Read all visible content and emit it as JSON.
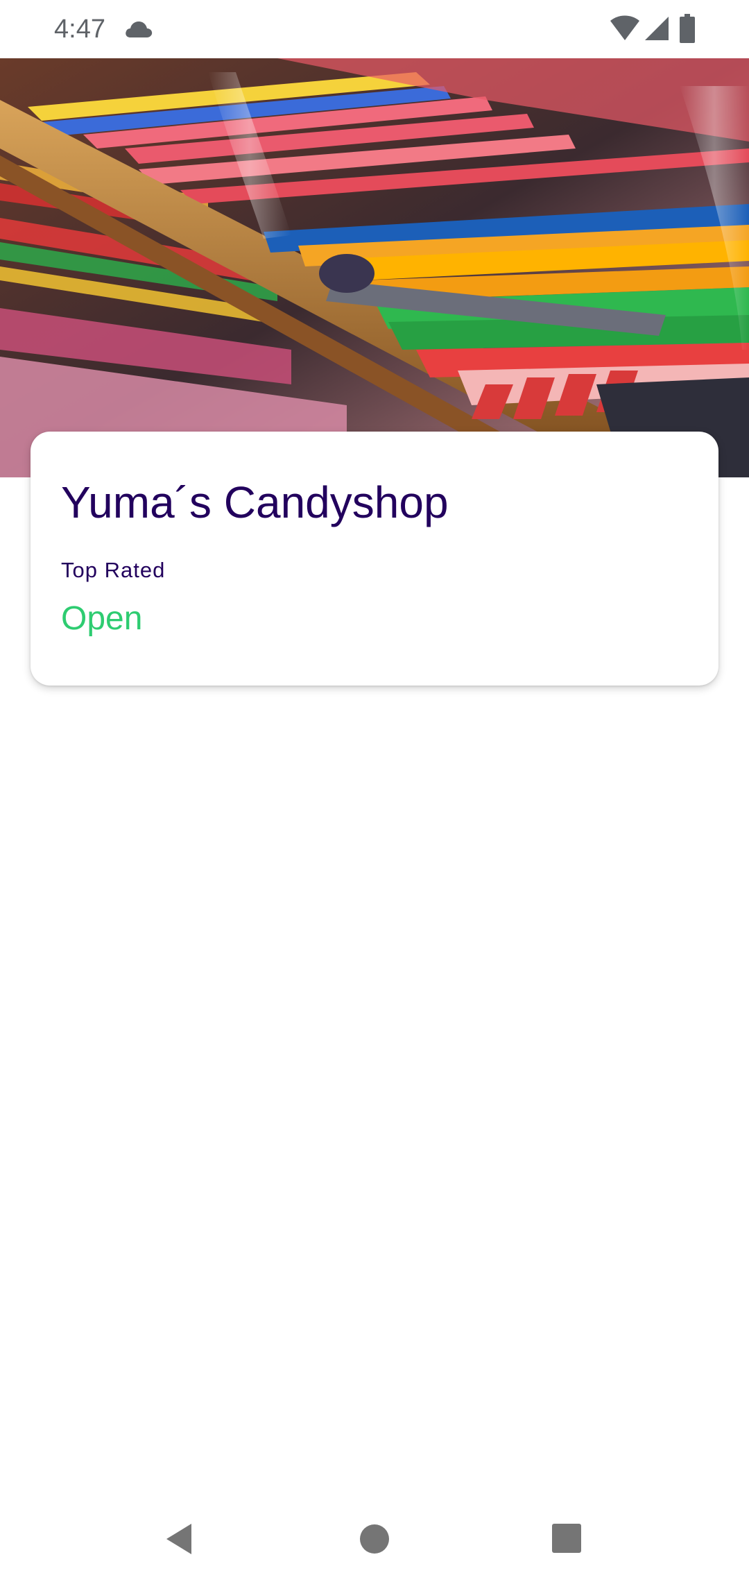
{
  "status_bar": {
    "time": "4:47",
    "icons": [
      "cloud-icon",
      "wifi-icon",
      "signal-icon",
      "battery-icon"
    ],
    "icon_color": "#5f6368"
  },
  "hero": {
    "image": "candy-sticks-photo"
  },
  "card": {
    "title": "Yuma´s Candyshop",
    "rating_label": "Top Rated",
    "status": "Open",
    "title_color": "#22005d",
    "status_color": "#2ecc71"
  },
  "nav_bar": {
    "icons": [
      "back-icon",
      "home-icon",
      "recents-icon"
    ],
    "icon_color": "#757575"
  }
}
